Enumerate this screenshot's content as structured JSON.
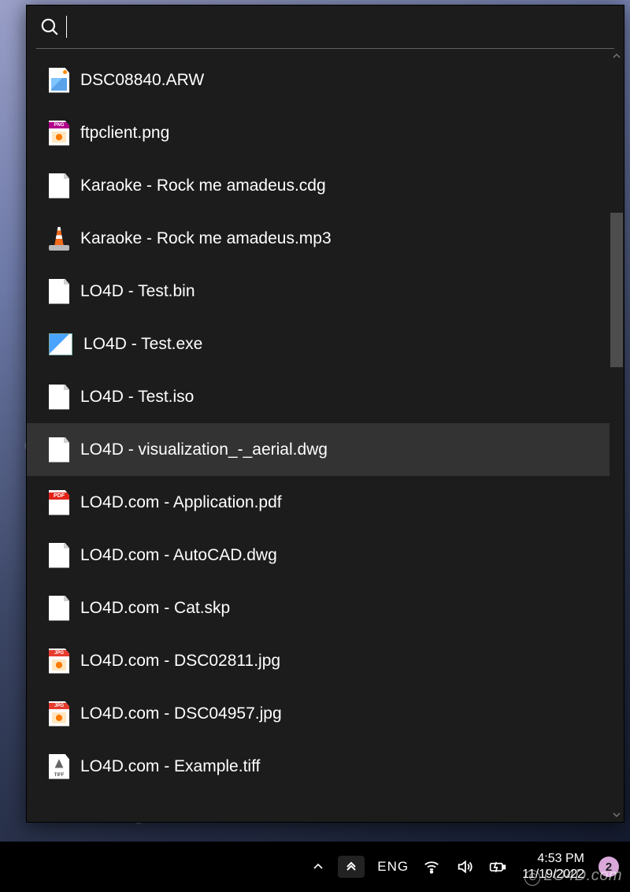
{
  "search": {
    "value": "",
    "placeholder": ""
  },
  "results": [
    {
      "name": "DSC08840.ARW",
      "icon": "img"
    },
    {
      "name": "ftpclient.png",
      "icon": "png"
    },
    {
      "name": "Karaoke - Rock me amadeus.cdg",
      "icon": "blank"
    },
    {
      "name": "Karaoke - Rock me amadeus.mp3",
      "icon": "vlc"
    },
    {
      "name": "LO4D - Test.bin",
      "icon": "blank"
    },
    {
      "name": "LO4D - Test.exe",
      "icon": "exe"
    },
    {
      "name": "LO4D - Test.iso",
      "icon": "blank"
    },
    {
      "name": "LO4D - visualization_-_aerial.dwg",
      "icon": "blank",
      "hovered": true
    },
    {
      "name": "LO4D.com - Application.pdf",
      "icon": "pdf"
    },
    {
      "name": "LO4D.com - AutoCAD.dwg",
      "icon": "blank"
    },
    {
      "name": "LO4D.com - Cat.skp",
      "icon": "blank"
    },
    {
      "name": "LO4D.com - DSC02811.jpg",
      "icon": "jpg"
    },
    {
      "name": "LO4D.com - DSC04957.jpg",
      "icon": "jpg"
    },
    {
      "name": "LO4D.com - Example.tiff",
      "icon": "tiff"
    }
  ],
  "taskbar": {
    "language": "ENG",
    "time": "4:53 PM",
    "date": "11/19/2022",
    "notification_count": "2"
  },
  "watermark": "LO4D.com"
}
